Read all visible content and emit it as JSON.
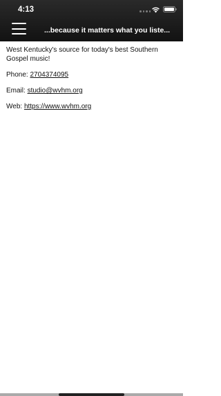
{
  "status_bar": {
    "time": "4:13"
  },
  "nav_bar": {
    "tagline": "...because it matters what you liste..."
  },
  "content": {
    "description": "West Kentucky's source for today's best Southern Gospel music!",
    "phone": {
      "label": "Phone: ",
      "value": "2704374095"
    },
    "email": {
      "label": "Email: ",
      "value": "studio@wvhm.org"
    },
    "web": {
      "label": "Web: ",
      "value": "https://www.wvhm.org"
    }
  }
}
